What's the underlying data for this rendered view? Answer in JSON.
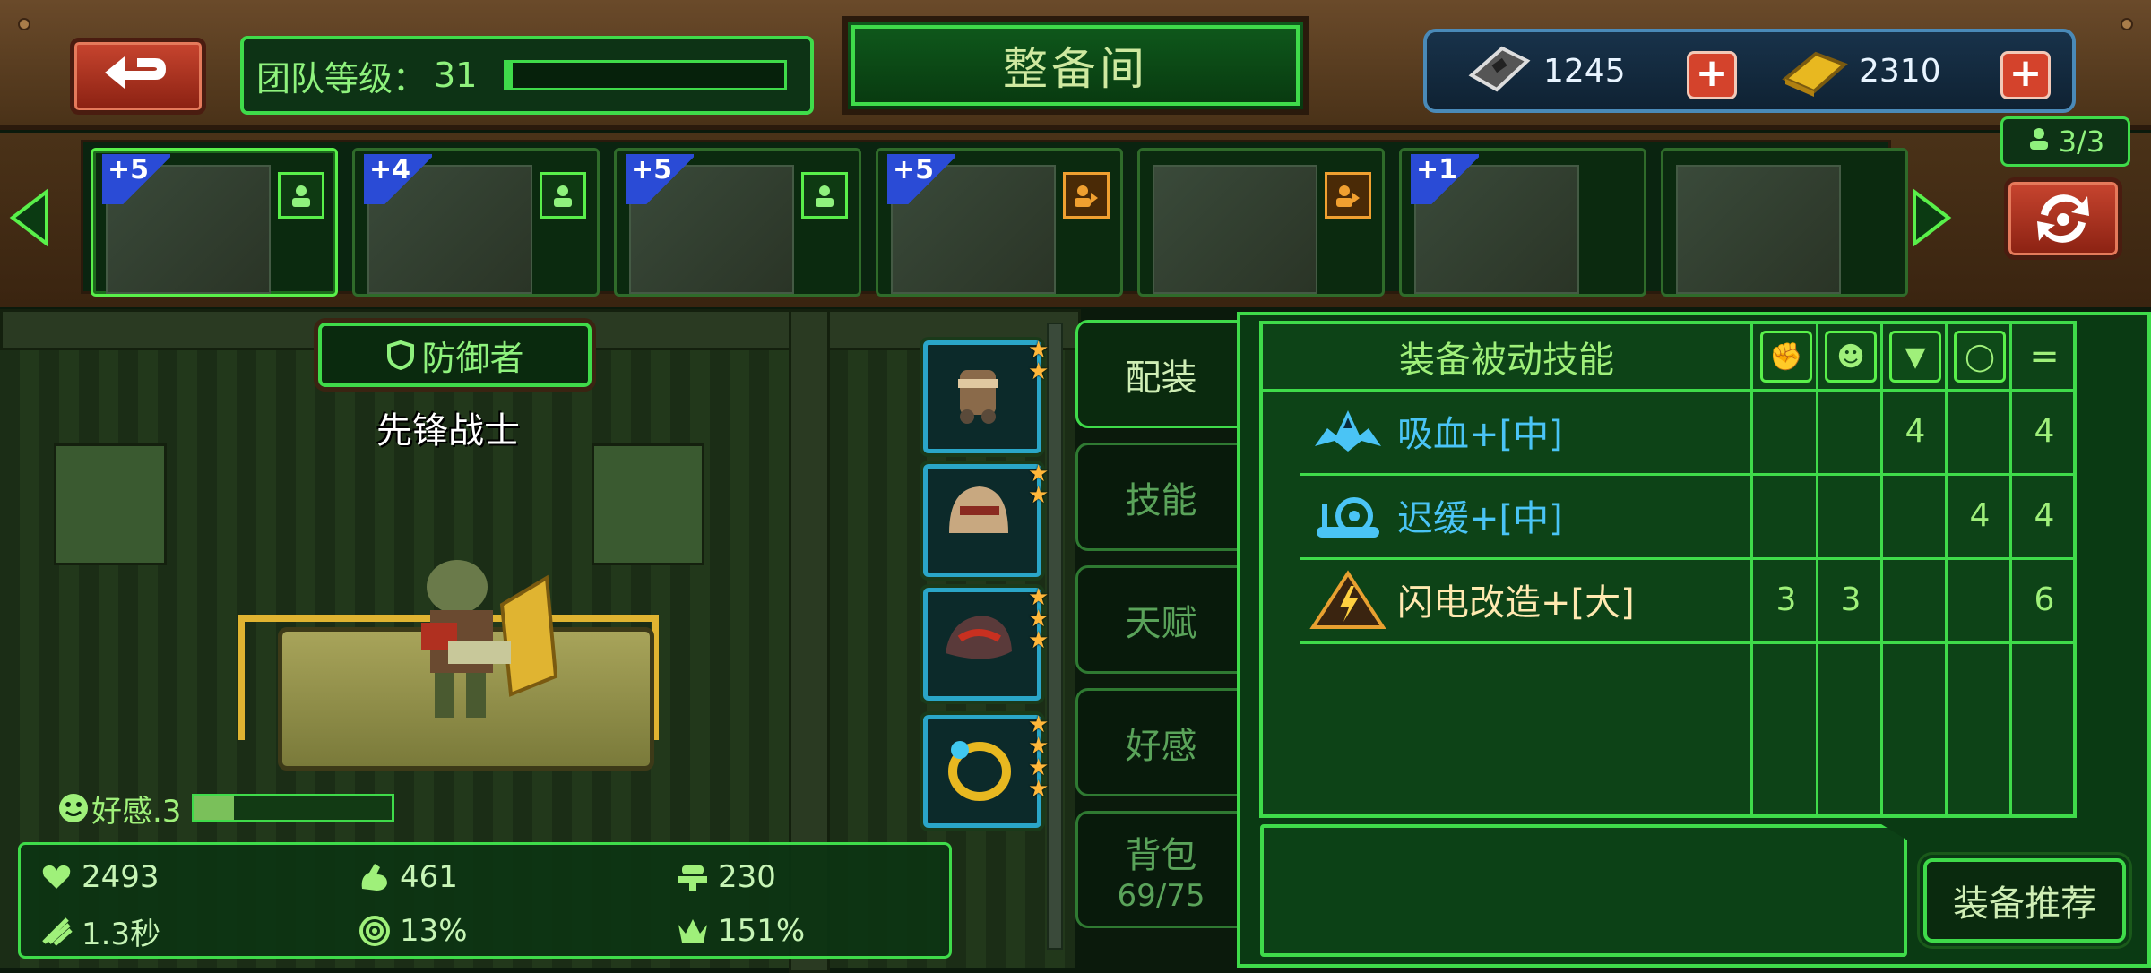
{
  "header": {
    "team_level_label": "团队等级：",
    "team_level": "31",
    "team_level_progress": 0.02,
    "title": "整备间"
  },
  "currency": {
    "chips": "1245",
    "gold": "2310",
    "plus_symbol": "+"
  },
  "roster": {
    "deploy_count": "3/3",
    "heroes": [
      {
        "plus": "+5",
        "role": "defender",
        "active": true
      },
      {
        "plus": "+4",
        "role": "defender",
        "active": false
      },
      {
        "plus": "+5",
        "role": "defender",
        "active": false
      },
      {
        "plus": "+5",
        "role": "attacker",
        "active": false
      },
      {
        "plus": "",
        "role": "attacker",
        "active": false
      },
      {
        "plus": "+1",
        "role": "",
        "active": false
      },
      {
        "plus": "",
        "role": "",
        "active": false
      }
    ]
  },
  "hero": {
    "role": "防御者",
    "name": "先锋战士",
    "affection_label": "好感.3",
    "affection_progress": 0.2
  },
  "stats": {
    "hp": "2493",
    "attack": "461",
    "defense": "230",
    "attack_speed": "1.3秒",
    "crit_rate": "13%",
    "crit_damage": "151%"
  },
  "equipment": {
    "slots": [
      {
        "icon": "gauntlet-icon",
        "stars": 2
      },
      {
        "icon": "helmet-icon",
        "stars": 2
      },
      {
        "icon": "armor-icon",
        "stars": 3
      },
      {
        "icon": "ring-icon",
        "stars": 4
      }
    ]
  },
  "tabs": {
    "loadout": "配装",
    "skills": "技能",
    "talent": "天赋",
    "affection": "好感",
    "bag_label": "背包",
    "bag_count": "69/75"
  },
  "passive_table": {
    "title": "装备被动技能",
    "total_symbol": "=",
    "rows": [
      {
        "name": "吸血+[中]",
        "color": "#4ac4f5",
        "icon": "bat-icon",
        "c1": "",
        "c2": "",
        "c3": "4",
        "c4": "",
        "total": "4"
      },
      {
        "name": "迟缓+[中]",
        "color": "#4ac4f5",
        "icon": "snail-icon",
        "c1": "",
        "c2": "",
        "c3": "",
        "c4": "4",
        "total": "4"
      },
      {
        "name": "闪电改造+[大]",
        "color": "#ffe9b0",
        "icon": "lightning-icon",
        "c1": "3",
        "c2": "3",
        "c3": "",
        "c4": "",
        "total": "6"
      }
    ]
  },
  "buttons": {
    "recommend": "装备推荐"
  },
  "colors": {
    "accent_green": "#3fdb4a",
    "frame_brown": "#6a4a2a",
    "button_red": "#c8452f",
    "star_gold": "#ffb73a"
  }
}
